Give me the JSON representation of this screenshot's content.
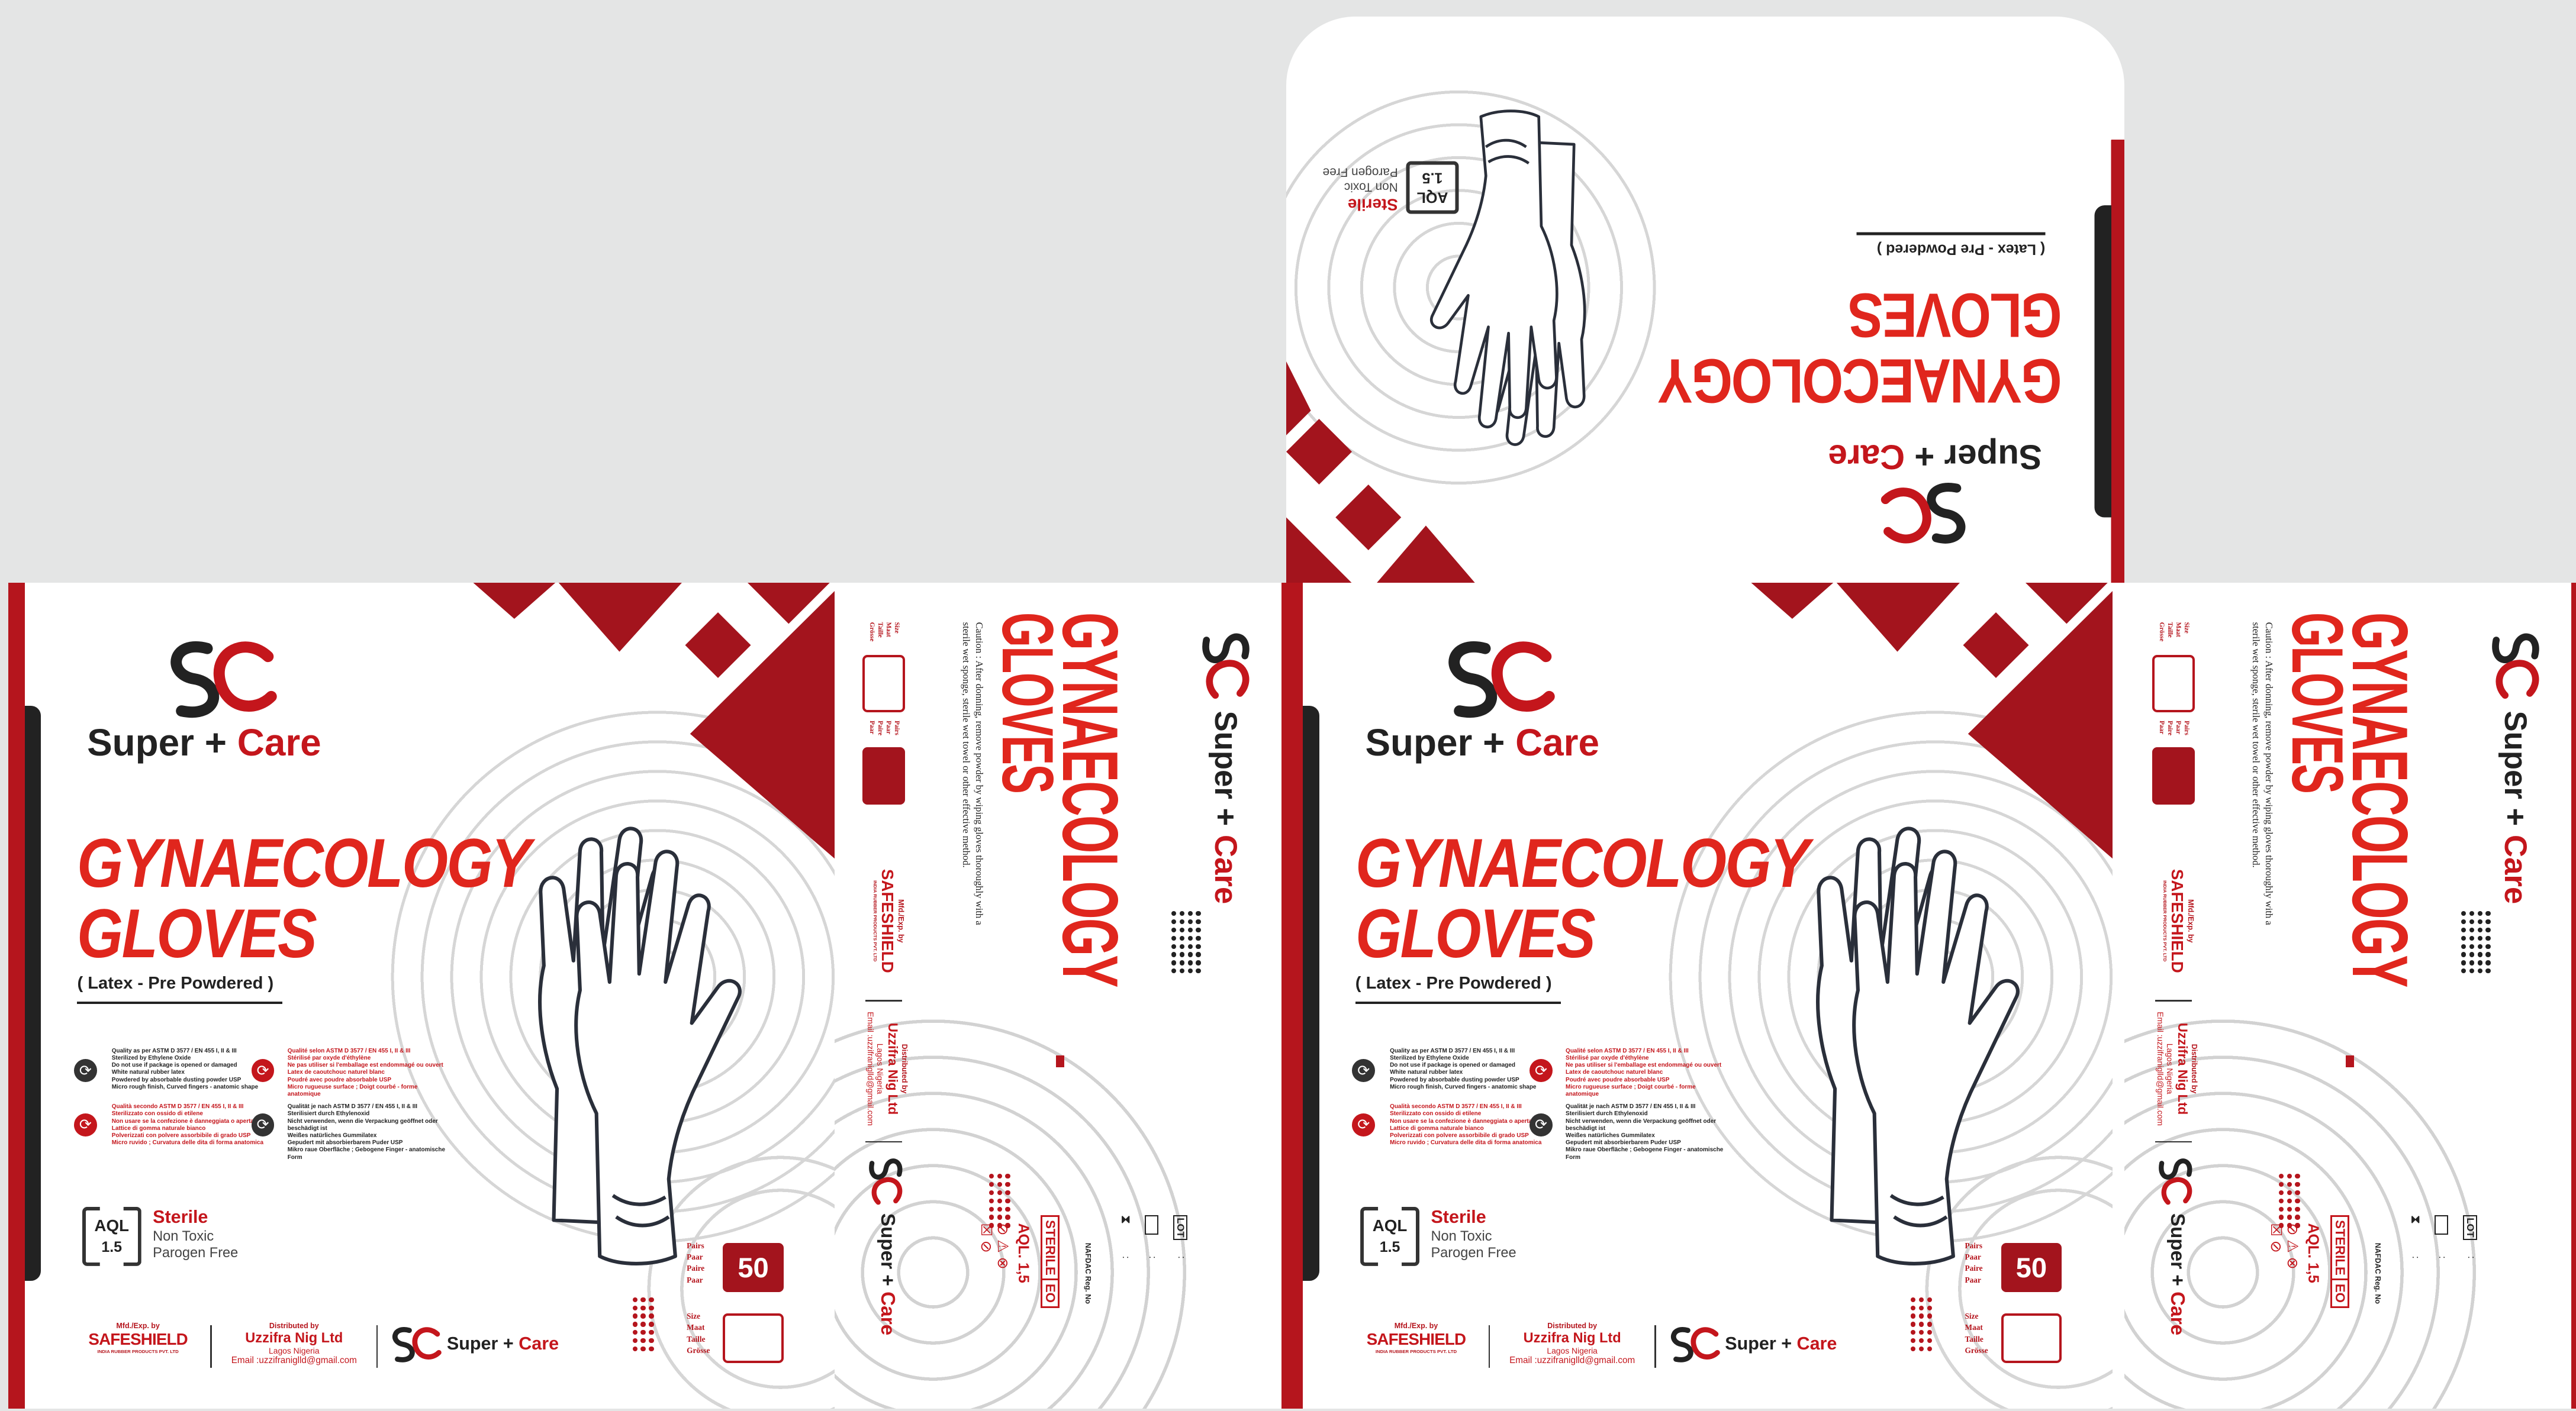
{
  "brand": {
    "monogram": "SC",
    "name_part1": "Super",
    "plus": "+",
    "name_part2": "Care"
  },
  "product": {
    "title_line1": "GYNAECOLOGY",
    "title_line2": "GLOVES",
    "subtitle": "( Latex - Pre Powdered )"
  },
  "aql": {
    "label": "AQL",
    "value": "1.5"
  },
  "features": {
    "sterile": "Sterile",
    "non_toxic": "Non Toxic",
    "pyrogen": "Parogen Free"
  },
  "quality": [
    {
      "text": "Quality as per ASTM D 3577 / EN 455 I, II & III\nSterilized by Ethylene Oxide\nDo not use if package is opened or damaged\nWhite natural rubber latex\nPowdered by absorbable dusting powder USP\nMicro rough finish, Curved fingers - anatomic shape"
    },
    {
      "text": "Qualité selon ASTM D 3577 / EN 455 I, II & III\nStérilisé par oxyde d'éthylène\nNe pas utiliser si l'emballage est endommagé ou ouvert\nLatex de caoutchouc naturel blanc\nPoudré avec poudre absorbable USP\nMicro rugueuse surface ; Doigt courbé - forme anatomique"
    },
    {
      "text": "Qualità secondo ASTM D 3577 / EN 455 I, II & III\nSterilizzato con ossido di etilene\nNon usare se la confezione è danneggiata o aperta\nLattice di gomma naturale bianco\nPolverizzati con polvere assorbibile di grado USP\nMicro ruvido ; Curvatura delle dita di forma anatomica"
    },
    {
      "text": "Qualität je nach ASTM D 3577 / EN 455 I, II & III\nSterilisiert durch Ethylenoxid\nNicht verwenden, wenn die Verpackung geöffnet oder beschädigt ist\nWeißes natürliches Gummilatex\nGepudert mit absorbierbarem Puder USP\nMikro raue Oberfläche ; Gebogene Finger - anatomische Form"
    }
  ],
  "count": {
    "value": "50",
    "labels": "Pairs\nPaar\nPaire\nPaar"
  },
  "size": {
    "labels": "Size\nMaat\nTaille\nGrösse"
  },
  "manufacturer": {
    "label": "Mfd./Exp. by",
    "name": "SAFESHIELD",
    "sub": "INDIA RUBBER PRODUCTS PVT. LTD"
  },
  "distributor": {
    "label": "Distributed by",
    "name": "Uzzifra Nig Ltd",
    "location": "Lagos Nigeria",
    "email": "Email :uzzifraniglld@gmail.com"
  },
  "caution": "Caution : After donning, remove powder by wiping gloves thoroughly with a sterile wet sponge, sterile wet towel or other effective method.",
  "side": {
    "sterile": "STERILE",
    "eo": "EO",
    "aql": "AQL. 1,5",
    "lot": "LOT",
    "colon": ":",
    "nafdac": "NAFDAC Reg. No"
  },
  "colors": {
    "brand_red": "#c4161c",
    "title_red": "#e0261d",
    "dark_red": "#a3141d",
    "background": "#e4e5e5"
  }
}
